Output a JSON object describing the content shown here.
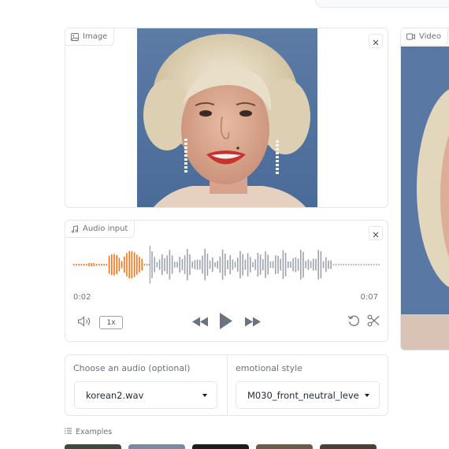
{
  "image_panel": {
    "label": "Image",
    "label_icon": "image-icon",
    "close_icon": "close-icon"
  },
  "video_panel": {
    "label": "Video",
    "label_icon": "video-icon"
  },
  "audio_panel": {
    "label": "Audio input",
    "label_icon": "music-note-icon",
    "current_time": "0:02",
    "duration": "0:07",
    "playback_rate": "1x",
    "progress_fraction": 0.25,
    "colors": {
      "played": "#f97316",
      "unplayed": "#9ca3af"
    }
  },
  "settings": {
    "audio_label": "Choose an audio (optional)",
    "audio_value": "korean2.wav",
    "style_label": "emotional style",
    "style_value": "M030_front_neutral_leve"
  },
  "examples": {
    "label": "Examples",
    "label_icon": "list-icon"
  }
}
